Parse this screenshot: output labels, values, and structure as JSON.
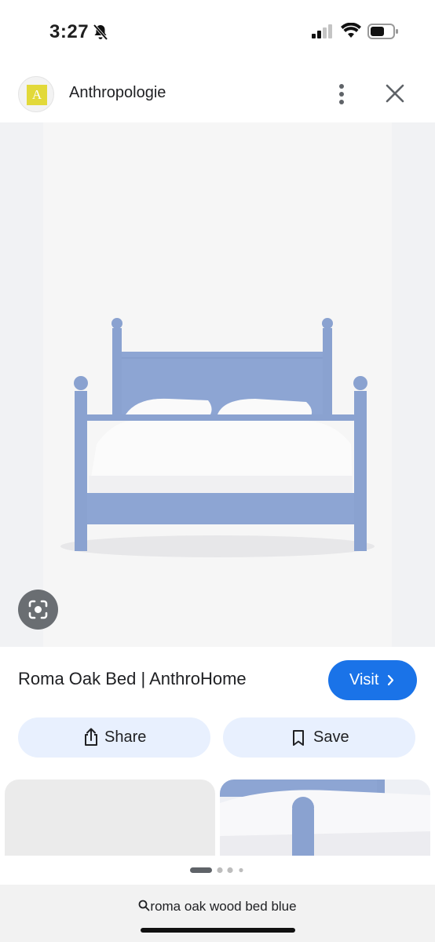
{
  "status_bar": {
    "time": "3:27"
  },
  "header": {
    "logo_letter": "A",
    "site_name": "Anthropologie"
  },
  "product": {
    "title": "Roma Oak Bed | AnthroHome",
    "visit_label": "Visit"
  },
  "actions": {
    "share_label": "Share",
    "save_label": "Save"
  },
  "search": {
    "query": "roma oak wood bed blue"
  },
  "icons": [
    "bell-slash-icon",
    "signal-icon",
    "wifi-icon",
    "battery-icon",
    "more-vert-icon",
    "close-icon",
    "lens-icon",
    "chevron-right-icon",
    "share-icon",
    "bookmark-icon",
    "search-icon"
  ],
  "colors": {
    "accent": "#1a73e8",
    "pill_bg": "#e8f0fe",
    "bed_blue": "#8fa6d2",
    "logo_yellow": "#e2d93a"
  }
}
